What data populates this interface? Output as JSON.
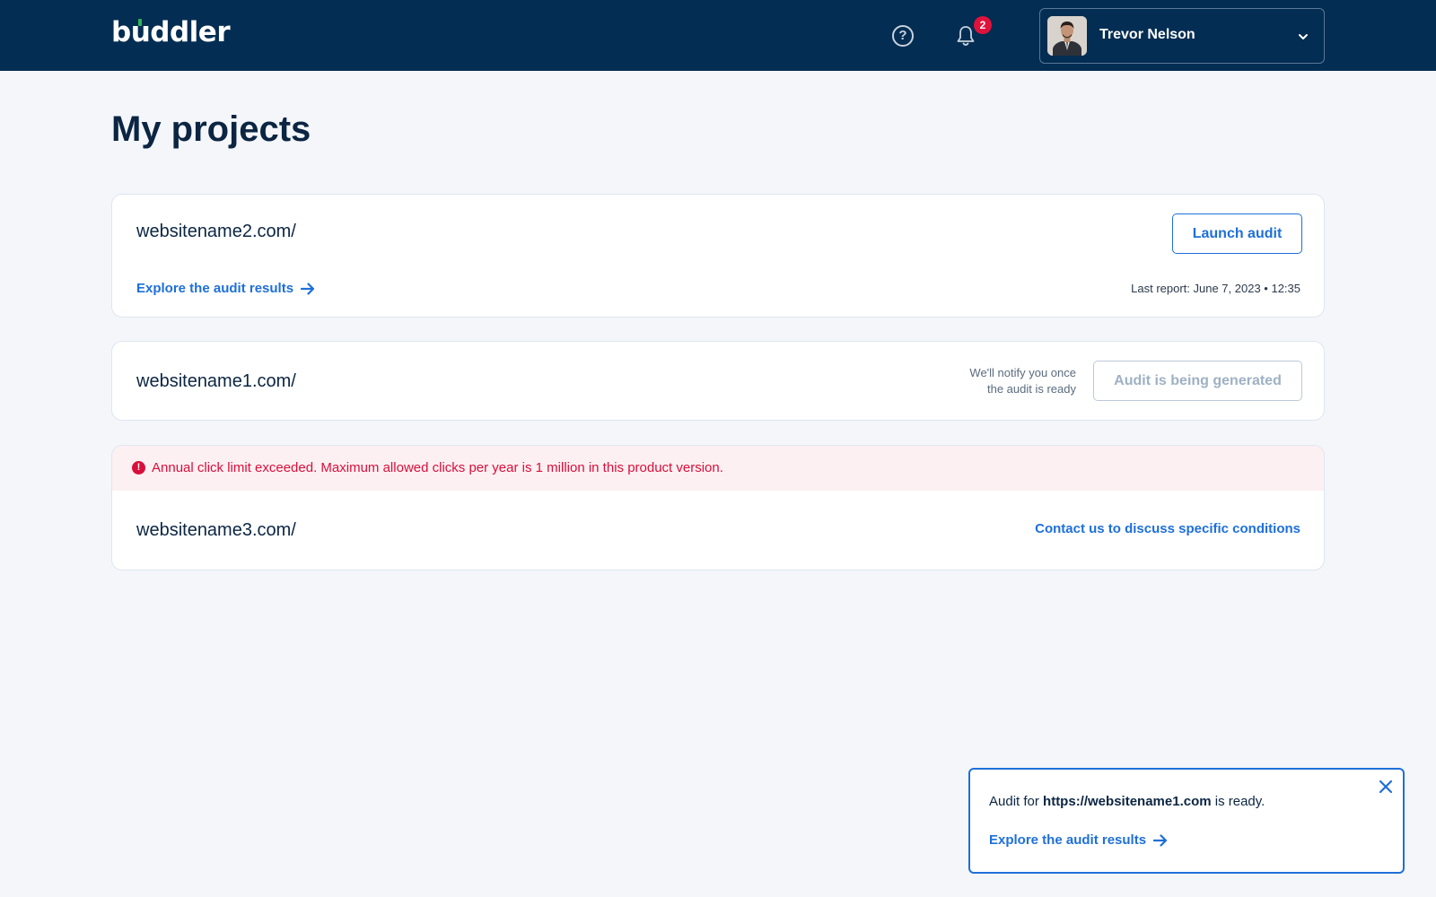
{
  "header": {
    "logo_text_pre": "b",
    "logo_text_u": "u",
    "logo_text_post": "ddler",
    "help_icon_glyph": "?",
    "notification_count": "2",
    "user_name": "Trevor Nelson"
  },
  "page": {
    "title": "My projects"
  },
  "projects": [
    {
      "site": "websitename2.com/",
      "action_label": "Launch audit",
      "link_label": "Explore the audit results",
      "last_report": "Last report: June 7, 2023  • 12:35"
    },
    {
      "site": "websitename1.com/",
      "notify_line1": "We'll notify you once",
      "notify_line2": "the audit is ready",
      "status_label": "Audit is being generated"
    },
    {
      "site": "websitename3.com/",
      "error_icon_glyph": "!",
      "error_message": "Annual click limit exceeded. Maximum allowed clicks per year is 1 million in this product version.",
      "contact_label": "Contact us to discuss specific conditions"
    }
  ],
  "toast": {
    "prefix": "Audit for ",
    "url": "https://websitename1.com",
    "suffix": " is ready.",
    "link_label": "Explore the audit results"
  },
  "colors": {
    "header_bg": "#032d52",
    "accent": "#1e6fd9",
    "error": "#d90f3b",
    "logo_dot": "#2fb457"
  },
  "icons": [
    "help-icon",
    "bell-icon",
    "chevron-down-icon",
    "arrow-right-icon",
    "error-icon",
    "close-icon"
  ]
}
